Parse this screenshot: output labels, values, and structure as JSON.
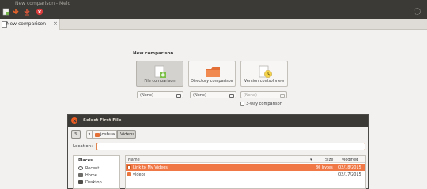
{
  "window": {
    "title": "New comparison - Meld"
  },
  "toolbar": {
    "buttons": [
      "new-comparison",
      "save",
      "undo",
      "stop"
    ],
    "spinner": "busy-spinner"
  },
  "tab": {
    "label": "New comparison",
    "close": "×"
  },
  "new_comparison": {
    "heading": "New comparison",
    "options": [
      {
        "label": "File comparison",
        "active": true
      },
      {
        "label": "Directory comparison",
        "active": false
      },
      {
        "label": "Version control view",
        "active": false
      }
    ],
    "choosers": [
      "(None)",
      "(None)",
      "(None)"
    ],
    "three_way_label": "3-way comparison"
  },
  "dialog": {
    "title": "Select First File",
    "edit_icon": "✎",
    "back_arrow": "◂",
    "path": [
      "joshua",
      "Videos"
    ],
    "location_label": "Location:",
    "location_value": "",
    "places": {
      "heading": "Places",
      "items": [
        "Recent",
        "Home",
        "Desktop"
      ]
    },
    "columns": {
      "name": "Name",
      "size": "Size",
      "modified": "Modified",
      "sort_indicator": "▾"
    },
    "files": [
      {
        "name": "Link to My Videos",
        "size": "80 bytes",
        "modified": "02/18/2015",
        "selected": true
      },
      {
        "name": "videos",
        "size": "",
        "modified": "02/17/2015",
        "selected": false
      }
    ]
  },
  "colors": {
    "accent": "#f07746",
    "titlebar": "#3b3a36",
    "background": "#f2f1f0"
  }
}
